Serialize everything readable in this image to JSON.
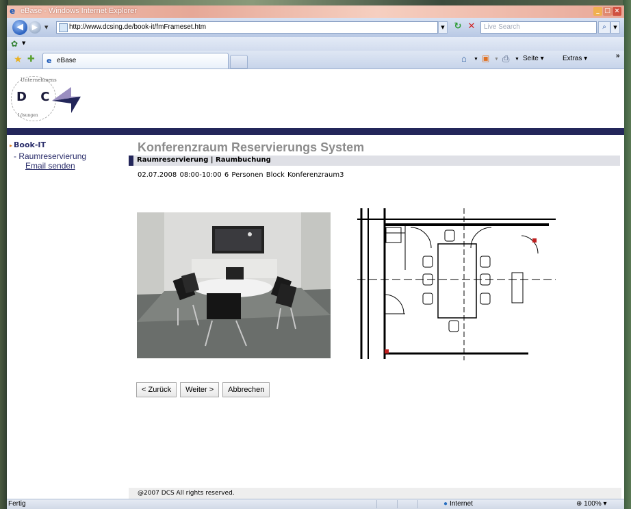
{
  "window": {
    "title": "eBase - Windows Internet Explorer",
    "min_label": "_",
    "max_label": "□",
    "close_label": "×"
  },
  "toolbar": {
    "url": "http://www.dcsing.de/book-it/fmFrameset.htm",
    "search_placeholder": "Live Search",
    "refresh_glyph": "↻",
    "stop_glyph": "✕"
  },
  "tabs": {
    "active_label": "eBase"
  },
  "commands": {
    "page_label": "Seite ▾",
    "tools_label": "Extras ▾",
    "more_label": "»"
  },
  "logo": {
    "letters": "D C S",
    "arc_top": "Unternehmens",
    "arc_bottom": "Lösungen"
  },
  "sidebar": {
    "heading": "Book-IT",
    "items": [
      {
        "label": "- Raumreservierung"
      },
      {
        "label": "Email senden"
      }
    ]
  },
  "main": {
    "title": "Konferenzraum Reservierungs System",
    "section": "Raumreservierung | Raumbuchung",
    "booking": {
      "date": "02.07.2008",
      "time": "08:00-10:00",
      "persons": "6 Personen",
      "type": "Block",
      "room": "Konferenzraum3"
    },
    "buttons": {
      "back": "< Zurück",
      "next": "Weiter >",
      "cancel": "Abbrechen"
    },
    "footer": "@2007 DCS All rights reserved."
  },
  "statusbar": {
    "status": "Fertig",
    "zone": "Internet",
    "zoom": "100%"
  },
  "colors": {
    "navy_band": "#23265a",
    "title_gray": "#8c8c8c",
    "section_bg": "#dfe0e6"
  }
}
